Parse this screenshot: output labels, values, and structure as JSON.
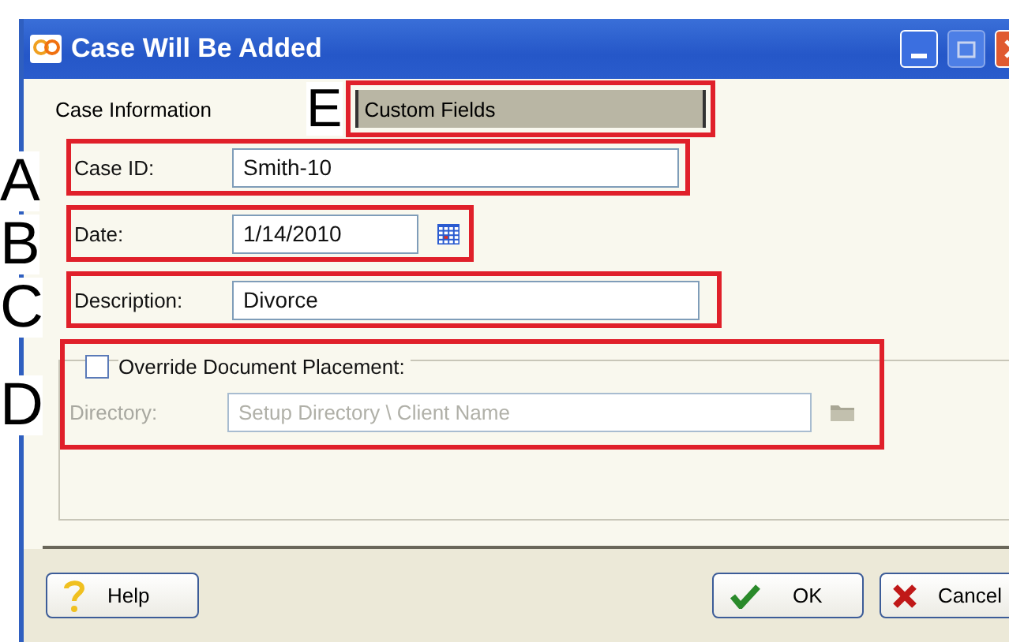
{
  "window": {
    "title": "Case Will Be Added"
  },
  "tabs": [
    {
      "label": "Case Information",
      "selected": true
    },
    {
      "label": "Custom Fields",
      "selected": false
    }
  ],
  "fields": [
    {
      "label": "Case ID:",
      "value": "Smith-10",
      "kind": "text"
    },
    {
      "label": "Date:",
      "value": "1/14/2010",
      "kind": "date"
    },
    {
      "label": "Description:",
      "value": "Divorce",
      "kind": "text"
    }
  ],
  "override": {
    "label": "Override Document Placement:",
    "checked": false
  },
  "directory": {
    "label": "Directory:",
    "placeholder": "Setup Directory \\ Client Name",
    "disabled": true
  },
  "buttons": [
    {
      "label": "Help",
      "kind": "help"
    },
    {
      "label": "OK",
      "kind": "ok"
    },
    {
      "label": "Cancel",
      "kind": "cancel"
    }
  ],
  "callouts": [
    "A",
    "B",
    "C",
    "D",
    "E"
  ]
}
